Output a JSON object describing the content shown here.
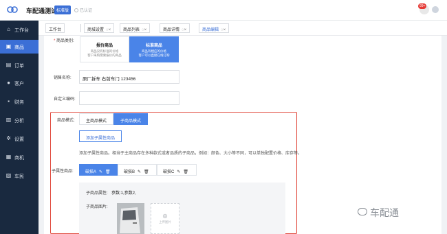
{
  "app": {
    "title": "车配通测试",
    "edition": "标准版",
    "cert_status": "已认证",
    "notif_count": "99+"
  },
  "sidebar": {
    "items": [
      {
        "label": "工作台",
        "icon": "home-icon"
      },
      {
        "label": "商品",
        "icon": "goods-icon"
      },
      {
        "label": "订单",
        "icon": "order-icon"
      },
      {
        "label": "客户",
        "icon": "customer-icon"
      },
      {
        "label": "财务",
        "icon": "finance-icon"
      },
      {
        "label": "分析",
        "icon": "analysis-icon"
      },
      {
        "label": "设置",
        "icon": "settings-icon"
      },
      {
        "label": "商机",
        "icon": "opportunity-icon"
      },
      {
        "label": "车民",
        "icon": "car-owner-icon"
      }
    ],
    "active_index": 1
  },
  "tabs": [
    {
      "label": "工作台"
    },
    {
      "label": "商城设置"
    },
    {
      "label": "商品列表"
    },
    {
      "label": "商品详情"
    },
    {
      "label": "商品编辑"
    }
  ],
  "form": {
    "category_label": "商品类别:",
    "type_quote": {
      "title": "报价商品",
      "desc1": "商品没有标准的价格",
      "desc2": "客户采购需要报价的商品"
    },
    "type_standard": {
      "title": "标准商品",
      "desc1": "商品有相应的价格",
      "desc2": "客户可以直接在线订购"
    },
    "sales_name_label": "销售名称:",
    "sales_name_value": "原厂拆车 右前车门 123456",
    "custom_code_label": "自定义编码:",
    "custom_code_value": "",
    "mode_label": "商品模式:",
    "mode_main": "主商品模式",
    "mode_sub": "子商品模式",
    "add_sub_button": "添加子属性商品",
    "description": "添加子属性商品。相当于主商品存在多种款式或者品质的子商品，例如：颜色、大小等不同，可以单独配置价格、库存等。",
    "sub_goods_label": "子属性商品:",
    "sub_tabs": [
      "破损A",
      "破损B",
      "破损C"
    ],
    "sub_attr_label": "子商品属性:",
    "sub_attr_value": "参数:1,参数2,",
    "sub_image_label": "子商品图片:",
    "upload_text": "上传图片"
  },
  "watermark": "车配通"
}
